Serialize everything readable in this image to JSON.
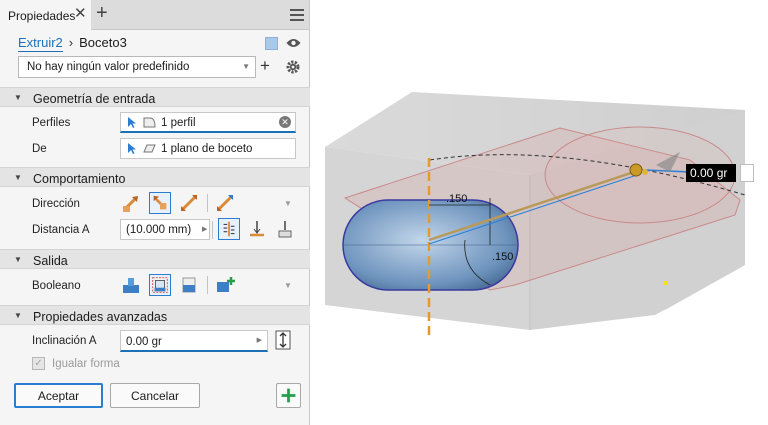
{
  "panel": {
    "tab_label": "Propiedades",
    "breadcrumb": {
      "parent": "Extruir2",
      "current": "Boceto3"
    },
    "preset_value": "No hay ningún valor predefinido",
    "sections": {
      "input_geometry": "Geometría de entrada",
      "behavior": "Comportamiento",
      "output": "Salida",
      "advanced": "Propiedades avanzadas"
    },
    "fields": {
      "profiles_label": "Perfiles",
      "profiles_value": "1 perfil",
      "from_label": "De",
      "from_value": "1 plano de boceto",
      "direction_label": "Dirección",
      "distance_label": "Distancia A",
      "distance_value": "(10.000 mm)",
      "boolean_label": "Booleano",
      "taper_label": "Inclinación A",
      "taper_value": "0.00 gr",
      "match_shape_label": "Igualar forma"
    },
    "buttons": {
      "ok": "Aceptar",
      "cancel": "Cancelar"
    },
    "icons": {
      "close": "close-icon",
      "add": "plus-icon",
      "menu": "hamburger-icon",
      "visibility": "eye-icon",
      "settings": "gear-icon",
      "accent": "#1d70b8"
    }
  },
  "viewport": {
    "dimension_150_a": ".150",
    "dimension_150_b": ".150",
    "distance_readout": "0.00 gr"
  }
}
